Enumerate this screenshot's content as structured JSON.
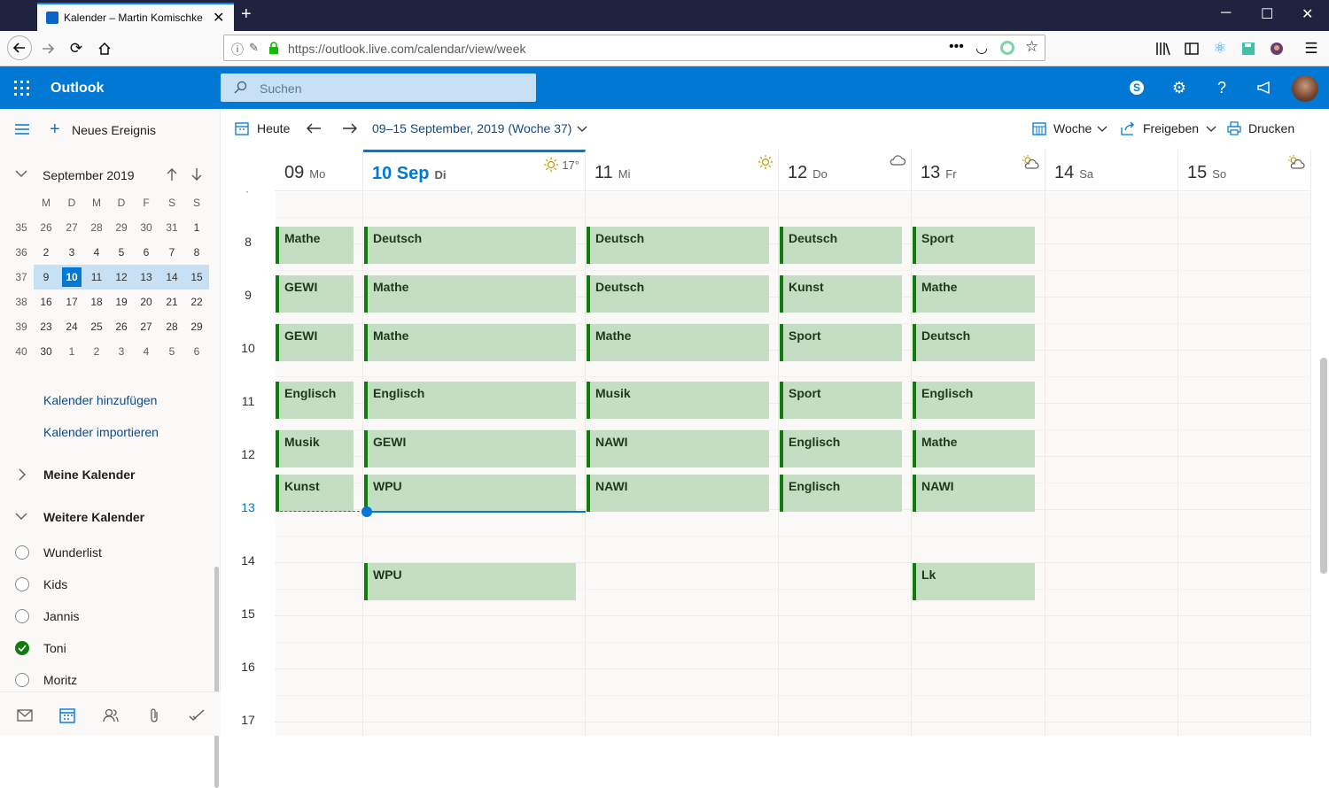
{
  "browser": {
    "tab_title": "Kalender – Martin Komischke – Outlook",
    "new_tab": "+",
    "url": "https://outlook.live.com/calendar/view/week"
  },
  "outlook": {
    "brand": "Outlook",
    "search_placeholder": "Suchen"
  },
  "left": {
    "new_event": "Neues Ereignis",
    "month_title": "September 2019",
    "weekday_headers": [
      "M",
      "D",
      "M",
      "D",
      "F",
      "S",
      "S"
    ],
    "weeks": [
      {
        "wk": "35",
        "days": [
          "26",
          "27",
          "28",
          "29",
          "30",
          "31",
          "1"
        ]
      },
      {
        "wk": "36",
        "days": [
          "2",
          "3",
          "4",
          "5",
          "6",
          "7",
          "8"
        ]
      },
      {
        "wk": "37",
        "days": [
          "9",
          "10",
          "11",
          "12",
          "13",
          "14",
          "15"
        ]
      },
      {
        "wk": "38",
        "days": [
          "16",
          "17",
          "18",
          "19",
          "20",
          "21",
          "22"
        ]
      },
      {
        "wk": "39",
        "days": [
          "23",
          "24",
          "25",
          "26",
          "27",
          "28",
          "29"
        ]
      },
      {
        "wk": "40",
        "days": [
          "30",
          "1",
          "2",
          "3",
          "4",
          "5",
          "6"
        ]
      }
    ],
    "add_calendar": "Kalender hinzufügen",
    "import_calendar": "Kalender importieren",
    "my_calendars": "Meine Kalender",
    "other_calendars": "Weitere Kalender",
    "calendars": [
      {
        "name": "Wunderlist",
        "checked": false
      },
      {
        "name": "Kids",
        "checked": false
      },
      {
        "name": "Jannis",
        "checked": false
      },
      {
        "name": "Toni",
        "checked": true
      },
      {
        "name": "Moritz",
        "checked": false
      }
    ]
  },
  "toolbar": {
    "today": "Heute",
    "range": "09–15 September, 2019 (Woche 37)",
    "view": "Woche",
    "share": "Freigeben",
    "print": "Drucken"
  },
  "days": [
    {
      "num": "09",
      "name": "Mo",
      "weather": ""
    },
    {
      "num": "10 Sep",
      "name": "Di",
      "weather": "17°"
    },
    {
      "num": "11",
      "name": "Mi",
      "weather": ""
    },
    {
      "num": "12",
      "name": "Do",
      "weather": ""
    },
    {
      "num": "13",
      "name": "Fr",
      "weather": ""
    },
    {
      "num": "14",
      "name": "Sa",
      "weather": ""
    },
    {
      "num": "15",
      "name": "So",
      "weather": ""
    }
  ],
  "hours": [
    "8",
    "9",
    "10",
    "11",
    "12",
    "13",
    "14",
    "15",
    "16",
    "17"
  ],
  "events": {
    "mo": [
      "Mathe",
      "GEWI",
      "GEWI",
      "Englisch",
      "Musik",
      "Kunst"
    ],
    "di": [
      "Deutsch",
      "Mathe",
      "Mathe",
      "Englisch",
      "GEWI",
      "WPU",
      "WPU"
    ],
    "mi": [
      "Deutsch",
      "Deutsch",
      "Mathe",
      "Musik",
      "NAWI",
      "NAWI"
    ],
    "do": [
      "Deutsch",
      "Kunst",
      "Sport",
      "Sport",
      "Englisch",
      "Englisch"
    ],
    "fr": [
      "Sport",
      "Mathe",
      "Deutsch",
      "Englisch",
      "Mathe",
      "NAWI",
      "Lk"
    ]
  },
  "colors": {
    "accent": "#0078d4",
    "event_fill": "#c4dec4",
    "event_border": "#107c10"
  }
}
